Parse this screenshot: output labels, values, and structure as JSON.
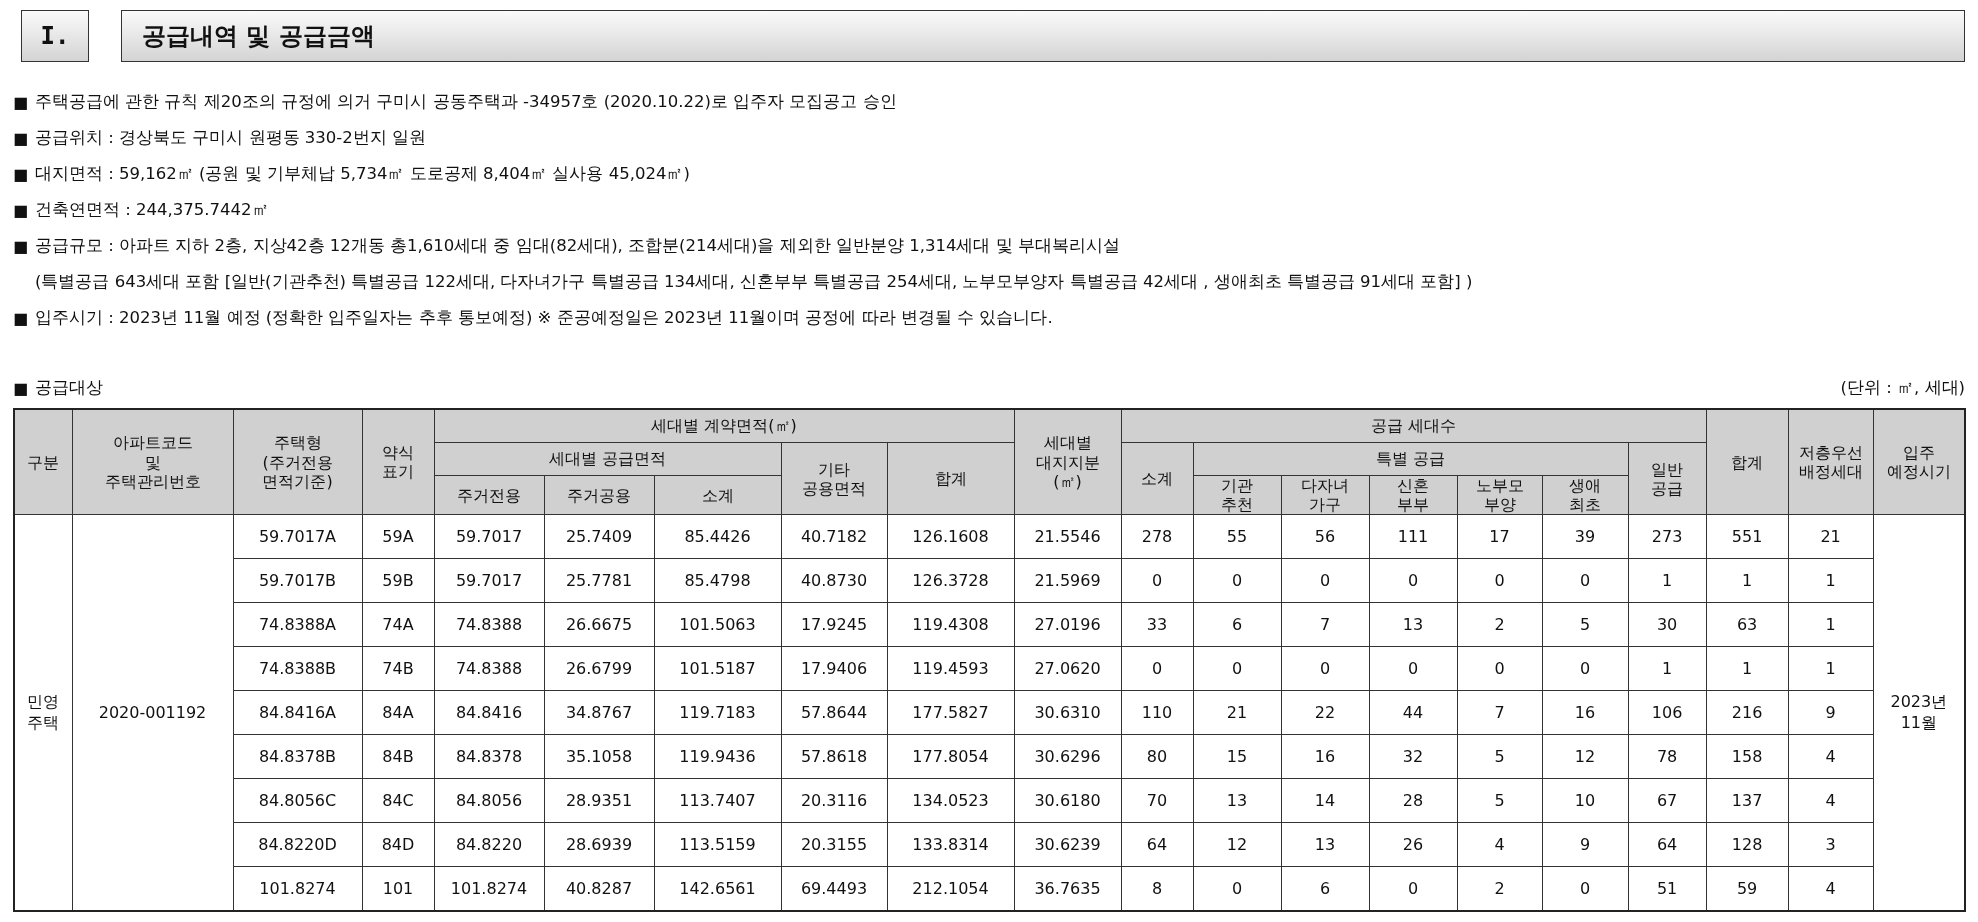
{
  "section": {
    "number": "I.",
    "title": "공급내역 및 공급금액"
  },
  "notes": [
    {
      "marker": "■",
      "lines": [
        "주택공급에 관한 규칙 제20조의 규정에 의거 구미시 공동주택과 -34957호 (2020.10.22)로 입주자 모집공고 승인"
      ]
    },
    {
      "marker": "■",
      "lines": [
        "공급위치 : 경상북도 구미시 원평동 330-2번지 일원"
      ]
    },
    {
      "marker": "■",
      "lines": [
        "대지면적 : 59,162㎡ (공원 및 기부체납 5,734㎡ 도로공제 8,404㎡ 실사용 45,024㎡)"
      ]
    },
    {
      "marker": "■",
      "lines": [
        "건축연면적 : 244,375.7442㎡"
      ]
    },
    {
      "marker": "■",
      "lines": [
        "공급규모 : 아파트 지하 2층, 지상42층 12개동 총1,610세대 중 임대(82세대), 조합분(214세대)을 제외한 일반분양 1,314세대 및 부대복리시설",
        "(특별공급 643세대 포함 [일반(기관추천) 특별공급 122세대, 다자녀가구 특별공급 134세대, 신혼부부 특별공급 254세대, 노부모부양자 특별공급 42세대 , 생애최초 특별공급 91세대 포함] )"
      ]
    },
    {
      "marker": "■",
      "lines": [
        "입주시기 : 2023년 11월 예정 (정확한 입주일자는 추후 통보예정) ※ 준공예정일은 2023년 11월이며 공정에 따라 변경될 수 있습니다."
      ]
    }
  ],
  "table_caption": {
    "marker": "■",
    "label": "공급대상",
    "unit": "(단위 : ㎡, 세대)"
  },
  "table": {
    "header_rows": [
      [
        {
          "text": "구분",
          "rowspan": 3
        },
        {
          "text": "아파트코드\n및\n주택관리번호",
          "rowspan": 3
        },
        {
          "text": "주택형\n(주거전용\n면적기준)",
          "rowspan": 3
        },
        {
          "text": "약식\n표기",
          "rowspan": 3
        },
        {
          "text": "세대별 계약면적(㎡)",
          "colspan": 5
        },
        {
          "text": "세대별\n대지지분\n(㎡)",
          "rowspan": 3
        },
        {
          "text": "공급 세대수",
          "colspan": 7
        },
        {
          "text": "합계",
          "rowspan": 3
        },
        {
          "text": "저층우선\n배정세대",
          "rowspan": 3
        },
        {
          "text": "입주\n예정시기",
          "rowspan": 3
        }
      ],
      [
        {
          "text": "세대별 공급면적",
          "colspan": 3
        },
        {
          "text": "기타\n공용면적",
          "rowspan": 2
        },
        {
          "text": "합계",
          "rowspan": 2
        },
        {
          "text": "소계",
          "rowspan": 2
        },
        {
          "text": "특별 공급",
          "colspan": 5
        },
        {
          "text": "일반\n공급",
          "rowspan": 2
        }
      ],
      [
        {
          "text": "주거전용"
        },
        {
          "text": "주거공용"
        },
        {
          "text": "소계"
        },
        {
          "text": "기관\n추천"
        },
        {
          "text": "다자녀\n가구"
        },
        {
          "text": "신혼\n부부"
        },
        {
          "text": "노부모\n부양"
        },
        {
          "text": "생애\n최초"
        }
      ]
    ],
    "group": {
      "category": "민영주택",
      "code": "2020-001192",
      "move_in": "2023년 11월"
    },
    "rows": [
      [
        "59.7017A",
        "59A",
        "59.7017",
        "25.7409",
        "85.4426",
        "40.7182",
        "126.1608",
        "21.5546",
        "278",
        "55",
        "56",
        "111",
        "17",
        "39",
        "273",
        "551",
        "21"
      ],
      [
        "59.7017B",
        "59B",
        "59.7017",
        "25.7781",
        "85.4798",
        "40.8730",
        "126.3728",
        "21.5969",
        "0",
        "0",
        "0",
        "0",
        "0",
        "0",
        "1",
        "1",
        "1"
      ],
      [
        "74.8388A",
        "74A",
        "74.8388",
        "26.6675",
        "101.5063",
        "17.9245",
        "119.4308",
        "27.0196",
        "33",
        "6",
        "7",
        "13",
        "2",
        "5",
        "30",
        "63",
        "1"
      ],
      [
        "74.8388B",
        "74B",
        "74.8388",
        "26.6799",
        "101.5187",
        "17.9406",
        "119.4593",
        "27.0620",
        "0",
        "0",
        "0",
        "0",
        "0",
        "0",
        "1",
        "1",
        "1"
      ],
      [
        "84.8416A",
        "84A",
        "84.8416",
        "34.8767",
        "119.7183",
        "57.8644",
        "177.5827",
        "30.6310",
        "110",
        "21",
        "22",
        "44",
        "7",
        "16",
        "106",
        "216",
        "9"
      ],
      [
        "84.8378B",
        "84B",
        "84.8378",
        "35.1058",
        "119.9436",
        "57.8618",
        "177.8054",
        "30.6296",
        "80",
        "15",
        "16",
        "32",
        "5",
        "12",
        "78",
        "158",
        "4"
      ],
      [
        "84.8056C",
        "84C",
        "84.8056",
        "28.9351",
        "113.7407",
        "20.3116",
        "134.0523",
        "30.6180",
        "70",
        "13",
        "14",
        "28",
        "5",
        "10",
        "67",
        "137",
        "4"
      ],
      [
        "84.8220D",
        "84D",
        "84.8220",
        "28.6939",
        "113.5159",
        "20.3155",
        "133.8314",
        "30.6239",
        "64",
        "12",
        "13",
        "26",
        "4",
        "9",
        "64",
        "128",
        "3"
      ],
      [
        "101.8274",
        "101",
        "101.8274",
        "40.8287",
        "142.6561",
        "69.4493",
        "212.1054",
        "36.7635",
        "8",
        "0",
        "6",
        "0",
        "2",
        "0",
        "51",
        "59",
        "4"
      ]
    ]
  }
}
